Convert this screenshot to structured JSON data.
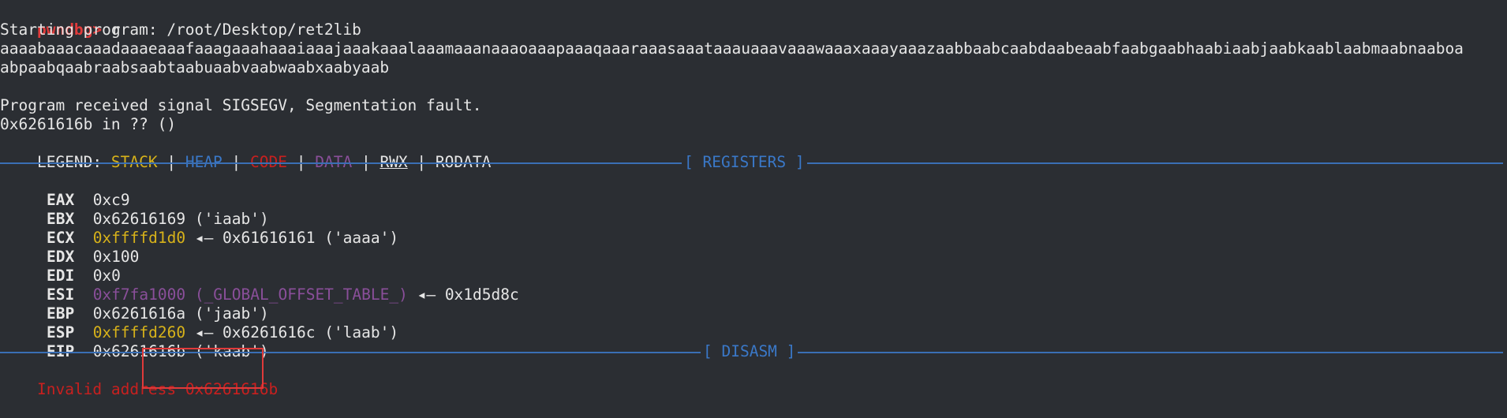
{
  "prompt": {
    "label": "pwndbg>",
    "command": " r"
  },
  "output": {
    "starting": "Starting program: /root/Desktop/ret2lib",
    "pattern_line1": "aaaabaaacaaadaaaeaaafaaagaaahaaaiaaajaaakaaalaaamaaanaaaoaaapaaaqaaaraaasaaataaauaaavaaawaaaxaaayaaazaabbaabcaabdaabeaabfaabgaabhaabiaabjaabkaablaabmaabnaaboa",
    "pattern_line2": "abpaabqaabraabsaabtaabuaabvaabwaabxaabyaab",
    "signal": "Program received signal SIGSEGV, Segmentation fault.",
    "location": "0x6261616b in ?? ()"
  },
  "legend": {
    "label": "LEGEND: ",
    "stack": "STACK",
    "heap": "HEAP",
    "code": "CODE",
    "data": "DATA",
    "rwx": "RWX",
    "rodata": "RODATA",
    "pipe": " | "
  },
  "sections": {
    "registers": "[ REGISTERS ]",
    "disasm": "[ DISASM ]"
  },
  "registers": [
    {
      "name": "EAX",
      "value": "0xc9",
      "rest": ""
    },
    {
      "name": "EBX",
      "value": "0x62616169 ('iaab')",
      "rest": ""
    },
    {
      "name": "ECX",
      "value": "0xffffd1d0",
      "rest": " ◂— 0x61616161 ('aaaa')"
    },
    {
      "name": "EDX",
      "value": "0x100",
      "rest": ""
    },
    {
      "name": "EDI",
      "value": "0x0",
      "rest": ""
    },
    {
      "name": "ESI",
      "value": "0xf7fa1000 (_GLOBAL_OFFSET_TABLE_)",
      "rest": " ◂— 0x1d5d8c"
    },
    {
      "name": "EBP",
      "value": "0x6261616a ('jaab')",
      "rest": ""
    },
    {
      "name": "ESP",
      "value": "0xffffd260",
      "rest": " ◂— 0x6261616c ('laab')"
    },
    {
      "name": "EIP",
      "value": "0x6261616b ('kaab')",
      "rest": ""
    }
  ],
  "disasm": {
    "invalid_label": "Invalid address ",
    "invalid_addr": "0x6261616b"
  },
  "colors": {
    "background": "#2b2e33",
    "stack": "#d7b21a",
    "heap": "#3a78c8",
    "code": "#c8201f",
    "data": "#8a4f9a",
    "highlight_box": "#e03a3a"
  }
}
